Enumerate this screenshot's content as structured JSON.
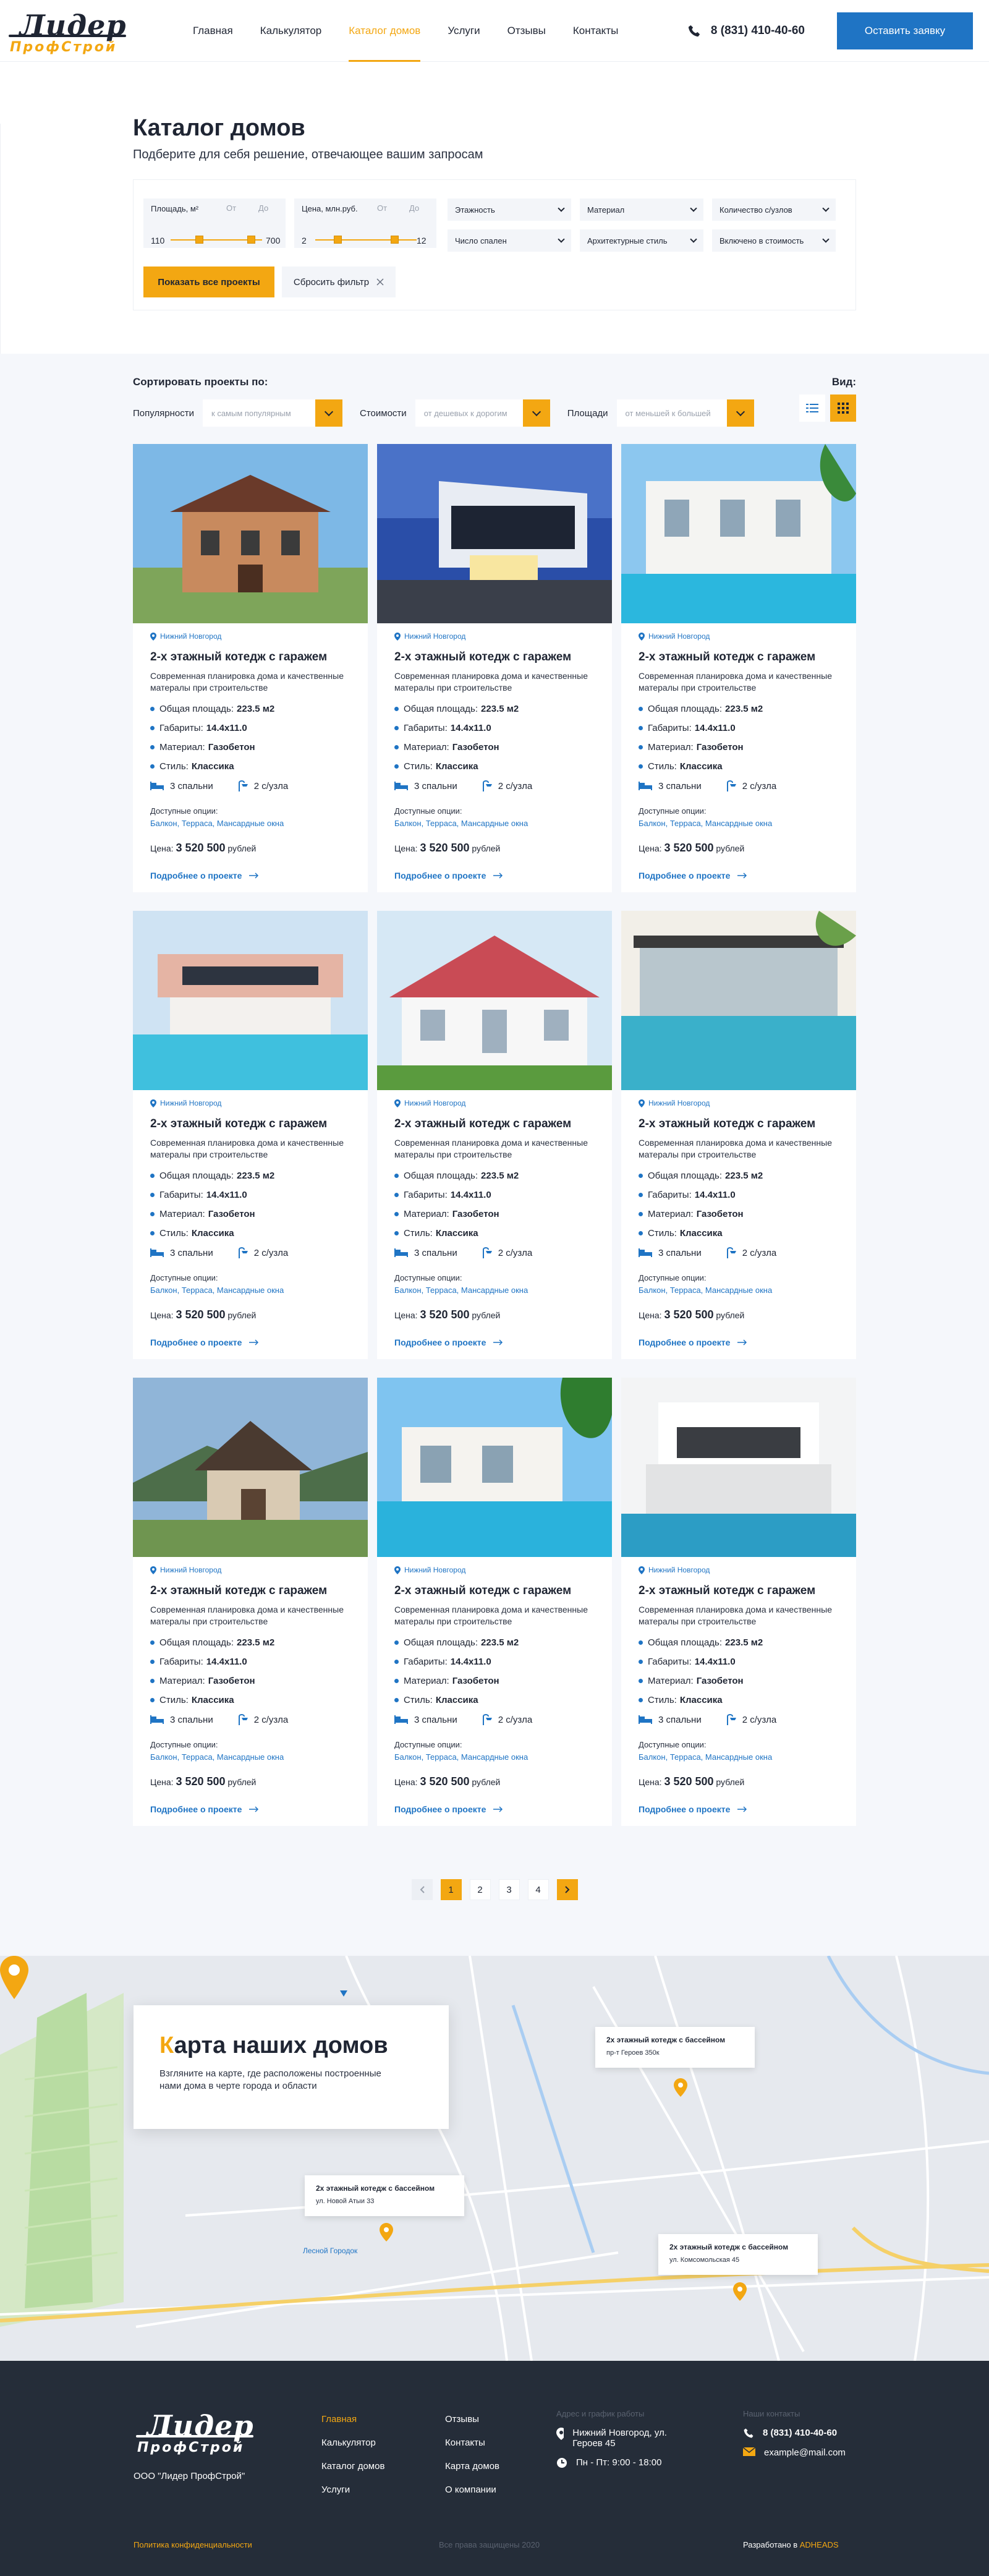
{
  "header": {
    "logo_top": "Лидер",
    "logo_bottom": "ПрофСтрой",
    "nav": [
      "Главная",
      "Калькулятор",
      "Каталог домов",
      "Услуги",
      "Отзывы",
      "Контакты"
    ],
    "phone": "8 (831) 410-40-60",
    "cta": "Оставить заявку"
  },
  "page": {
    "title": "Каталог домов",
    "subtitle": "Подберите для себя решение, отвечающее вашим запросам"
  },
  "filters": {
    "area": {
      "label": "Площадь, м²",
      "from": "От",
      "to": "До",
      "min": "110",
      "max": "700"
    },
    "price": {
      "label": "Цена, млн.руб.",
      "from": "От",
      "to": "До",
      "min": "2",
      "max": "12"
    },
    "selects": [
      "Этажность",
      "Материал",
      "Количество с/узлов",
      "Число спален",
      "Архитектурные стиль",
      "Включено в стоимость"
    ],
    "show_all": "Показать все проекты",
    "reset": "Сбросить фильтр"
  },
  "sort": {
    "title": "Сортировать проекты по:",
    "view_label": "Вид:",
    "popular_label": "Популярности",
    "popular_value": "к самым популярным",
    "cost_label": "Стоимости",
    "cost_value": "от дешевых к дорогим",
    "area_label": "Площади",
    "area_value": "от меньшей к большей"
  },
  "card_template": {
    "location": "Нижний Новгород",
    "title": "2-х этажный котедж с гаражем",
    "desc": "Современная планировка дома и качественные матерaлы при строительстве",
    "area_label": "Общая площадь:",
    "area_value": "223.5 м2",
    "dims_label": "Габариты:",
    "dims_value": "14.4x11.0",
    "material_label": "Материал:",
    "material_value": "Газобетон",
    "style_label": "Стиль:",
    "style_value": "Классика",
    "bedrooms": "3 спальни",
    "baths": "2 с/узла",
    "options_label": "Доступные опции:",
    "options_value": "Балкон, Терраса, Мансардные окна",
    "price_label": "Цена:",
    "price_value": "3 520 500",
    "price_unit": "рублей",
    "more": "Подробнее о проекте"
  },
  "cards": [
    {
      "scene": "brick"
    },
    {
      "scene": "modern-night"
    },
    {
      "scene": "pool-white"
    },
    {
      "scene": "pink-villa"
    },
    {
      "scene": "red-roof"
    },
    {
      "scene": "glass-pool"
    },
    {
      "scene": "chalet"
    },
    {
      "scene": "palm-pool"
    },
    {
      "scene": "modern-white"
    }
  ],
  "pagination": [
    "1",
    "2",
    "3",
    "4"
  ],
  "map": {
    "title_first": "К",
    "title_rest": "арта наших домов",
    "desc": "Взгляните на карте, где расположены построенные нами дома в черте города и области",
    "pins": [
      {
        "title": "2х этажный котедж с бассейном",
        "addr": "пр-т Героев 350к"
      },
      {
        "title": "2х этажный котедж с бассейном",
        "addr": "ул. Новой Атыи 33"
      },
      {
        "title": "2х этажный котедж с бассейном",
        "addr": "ул. Комсомольская 45"
      }
    ],
    "labels": [
      "Лесной Городок"
    ]
  },
  "footer": {
    "company": "ООО \"Лидер ПрофСтрой\"",
    "col1": [
      "Главная",
      "Калькулятор",
      "Каталог домов",
      "Услуги"
    ],
    "col2": [
      "Отзывы",
      "Контакты",
      "Карта домов",
      "О компании"
    ],
    "addr_head": "Адрес и график работы",
    "address": "Нижний Новгород, ул. Героев 45",
    "hours": "Пн - Пт: 9:00 - 18:00",
    "contacts_head": "Наши контакты",
    "phone": "8 (831) 410-40-60",
    "email": "example@mail.com",
    "policy": "Политика конфиденциальности",
    "copyright": "Все права защищены 2020",
    "dev_prefix": "Разработано в",
    "dev_name": "ADHEADS"
  },
  "colors": {
    "accent": "#f3a712",
    "blue": "#1f74c4",
    "dark": "#252d39"
  }
}
